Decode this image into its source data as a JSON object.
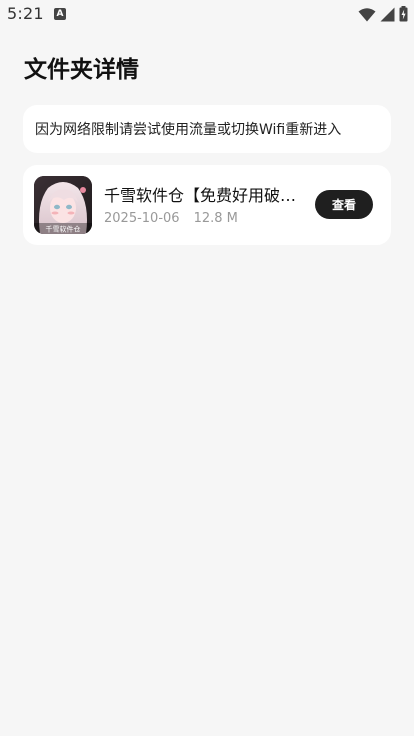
{
  "status_bar": {
    "time": "5:21",
    "app_icon_letter": "A"
  },
  "page": {
    "title": "文件夹详情"
  },
  "notice": {
    "text": "因为网络限制请尝试使用流量或切换Wifi重新进入"
  },
  "files": [
    {
      "name": "千雪软件仓【免费好用破解软件",
      "date": "2025-10-06",
      "size": "12.8 M",
      "action_label": "查看",
      "thumb_caption": "千雪软件仓"
    }
  ],
  "colors": {
    "background": "#f6f6f6",
    "card": "#ffffff",
    "button": "#1f1f1f",
    "meta_text": "#999999"
  }
}
